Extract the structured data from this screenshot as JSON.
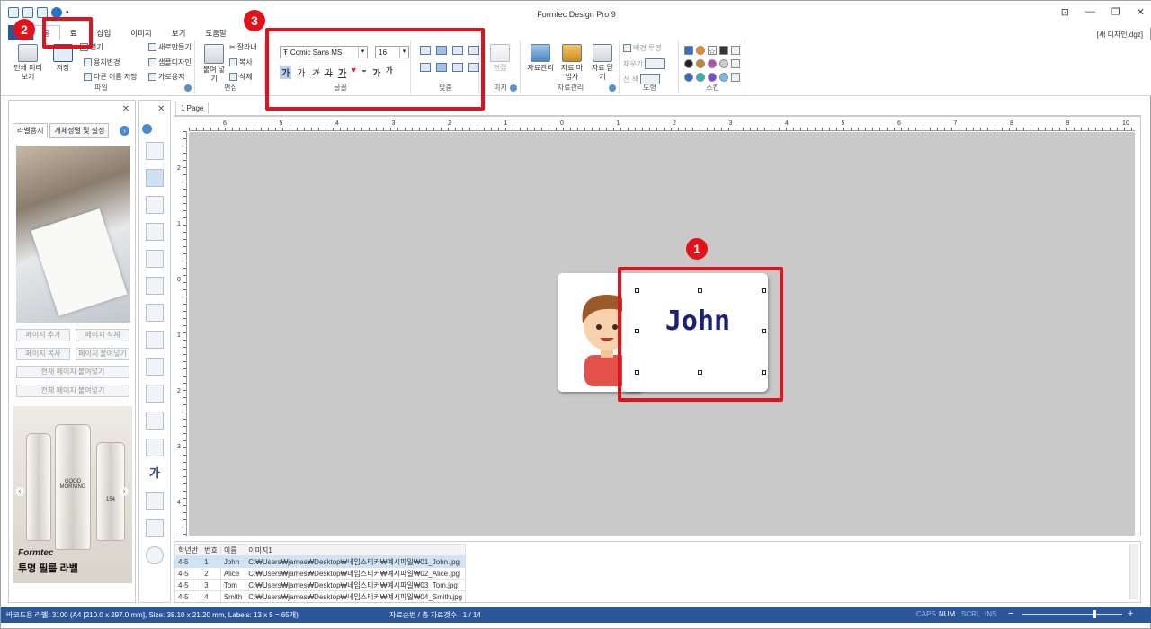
{
  "window": {
    "title": "Formtec Design Pro 9",
    "document": "[새 디자인.dgz]"
  },
  "tabs": [
    {
      "label": "홈",
      "active": true
    },
    {
      "label": "료"
    },
    {
      "label": "삽입"
    },
    {
      "label": "이미지"
    },
    {
      "label": "보기"
    },
    {
      "label": "도움말"
    }
  ],
  "ribbon": {
    "file_group": {
      "label": "파일",
      "print_preview": "인쇄 미리보기",
      "save": "저장",
      "open": "열기",
      "change_paper": "용지변경",
      "save_as": "다른 이름 저장",
      "new": "새로만들기",
      "sample_design": "샘플디자인",
      "landscape": "가로용지"
    },
    "edit_group": {
      "label": "편집",
      "paste": "붙여 넣기",
      "cut": "잘라내",
      "copy": "복사",
      "delete": "삭제"
    },
    "font_group": {
      "label": "글꼴",
      "font_name": "Comic Sans MS",
      "font_size": "16"
    },
    "align_group": {
      "label": "맞춤"
    },
    "image_group": {
      "label": "미지",
      "edit": "편집"
    },
    "data_group": {
      "label": "자료관리",
      "manage": "자료관리",
      "wizard": "자료 마법사",
      "close": "자료 닫기"
    },
    "shape_group": {
      "label": "도형",
      "transparent_bg": "배경 투명",
      "fill": "채우기",
      "line_color": "선 색"
    },
    "skin_group": {
      "label": "스킨"
    }
  },
  "left_panel": {
    "tabs": [
      "라벨용지",
      "개체정렬 및 설정"
    ],
    "buttons": {
      "add_page": "페이지 추가",
      "delete_page": "페이지 삭제",
      "copy_page": "페이지 복사",
      "paste_page": "페이지 붙여넣기",
      "paste_current": "현재 페이지 붙여넣기",
      "paste_all": "전체 페이지 붙여넣기"
    },
    "promo": {
      "brand": "Formtec",
      "title": "투명 필름 라벨",
      "bottle_text": "GOOD MORNING",
      "bottle_number": "154"
    }
  },
  "design": {
    "page_tab": "1 Page",
    "label_text": "John",
    "ruler_h": [
      "6",
      "5",
      "4",
      "3",
      "2",
      "1",
      "0",
      "1",
      "2",
      "3",
      "4",
      "5",
      "6",
      "7",
      "8",
      "9",
      "10"
    ],
    "ruler_v": [
      "2",
      "1",
      "0",
      "1",
      "2",
      "3",
      "4"
    ]
  },
  "data_grid": {
    "columns": [
      "학년반",
      "번호",
      "이름",
      "이미지1"
    ],
    "rows": [
      [
        "4-5",
        "1",
        "John",
        "C:₩Users₩james₩Desktop₩네임스티커₩예시파일₩01_John.jpg"
      ],
      [
        "4-5",
        "2",
        "Alice",
        "C:₩Users₩james₩Desktop₩네임스티커₩예시파일₩02_Alice.jpg"
      ],
      [
        "4-5",
        "3",
        "Tom",
        "C:₩Users₩james₩Desktop₩네임스티커₩예시파일₩03_Tom.jpg"
      ],
      [
        "4-5",
        "4",
        "Smith",
        "C:₩Users₩james₩Desktop₩네임스티커₩예시파일₩04_Smith.jpg"
      ]
    ]
  },
  "status": {
    "label_info": "바코드용 라벨: 3100 (A4 [210.0 x 297.0 mm], Size: 38.10 x 21.20 mm, Labels: 13 x 5 = 65개)",
    "record_info": "자료순번 / 총 자료갯수 : 1 / 14",
    "caps": "CAPS",
    "num": "NUM",
    "scrl": "SCRL",
    "ins": "INS",
    "zoom_minus": "−",
    "zoom_plus": "+"
  },
  "annotations": [
    "1",
    "2",
    "3"
  ],
  "colors": {
    "accent": "#2b579a",
    "annotation": "#e3121a",
    "label_text": "#1b1f7a"
  }
}
